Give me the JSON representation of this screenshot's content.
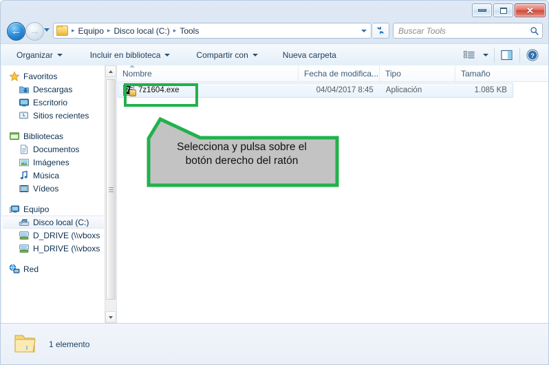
{
  "window": {
    "controls": {
      "minimize": "–",
      "maximize": "□",
      "close": "✕"
    }
  },
  "nav": {
    "back_label": "◀",
    "forward_label": "▶",
    "breadcrumb": [
      "Equipo",
      "Disco local (C:)",
      "Tools"
    ],
    "separator": "▸",
    "refresh_name": "refresh-icon",
    "search": {
      "placeholder": "Buscar Tools",
      "icon": "search-icon"
    }
  },
  "commandbar": {
    "items": [
      {
        "label": "Organizar",
        "has_caret": true
      },
      {
        "label": "Incluir en biblioteca",
        "has_caret": true
      },
      {
        "label": "Compartir con",
        "has_caret": true
      },
      {
        "label": "Nueva carpeta",
        "has_caret": false
      }
    ],
    "view_icon": "list-view-icon",
    "view_caret": "▾",
    "preview_icon": "preview-pane-icon",
    "help_icon": "help-icon",
    "help_glyph": "?"
  },
  "sidebar": {
    "groups": [
      {
        "header": "Favoritos",
        "header_icon": "star-icon",
        "items": [
          {
            "label": "Descargas",
            "icon": "downloads-icon"
          },
          {
            "label": "Escritorio",
            "icon": "desktop-icon"
          },
          {
            "label": "Sitios recientes",
            "icon": "recent-places-icon"
          }
        ]
      },
      {
        "header": "Bibliotecas",
        "header_icon": "libraries-icon",
        "items": [
          {
            "label": "Documentos",
            "icon": "documents-icon"
          },
          {
            "label": "Imágenes",
            "icon": "pictures-icon"
          },
          {
            "label": "Música",
            "icon": "music-icon"
          },
          {
            "label": "Vídeos",
            "icon": "videos-icon"
          }
        ]
      },
      {
        "header": "Equipo",
        "header_icon": "computer-icon",
        "items": [
          {
            "label": "Disco local (C:)",
            "icon": "harddrive-icon",
            "selected": true
          },
          {
            "label": "D_DRIVE (\\\\vboxs",
            "icon": "network-drive-icon"
          },
          {
            "label": "H_DRIVE (\\\\vboxs",
            "icon": "network-drive-icon"
          }
        ]
      },
      {
        "header": "Red",
        "header_icon": "network-icon",
        "items": []
      }
    ]
  },
  "filelist": {
    "columns": [
      {
        "key": "name",
        "label": "Nombre",
        "sorted": true
      },
      {
        "key": "date",
        "label": "Fecha de modifica..."
      },
      {
        "key": "type",
        "label": "Tipo"
      },
      {
        "key": "size",
        "label": "Tamaño"
      }
    ],
    "rows": [
      {
        "name": "7z1604.exe",
        "date": "04/04/2017 8:45",
        "type": "Aplicación",
        "size": "1.085 KB",
        "icon": "7zip-exe-icon",
        "selected": true
      }
    ]
  },
  "annotation": {
    "text_line1": "Selecciona y pulsa sobre el",
    "text_line2": "botón derecho del ratón",
    "border_color": "#22b14c",
    "fill_color": "#c3c3c3",
    "highlight_color": "#22b14c"
  },
  "statusbar": {
    "folder_icon": "folder-icon",
    "text": "1 elemento"
  }
}
